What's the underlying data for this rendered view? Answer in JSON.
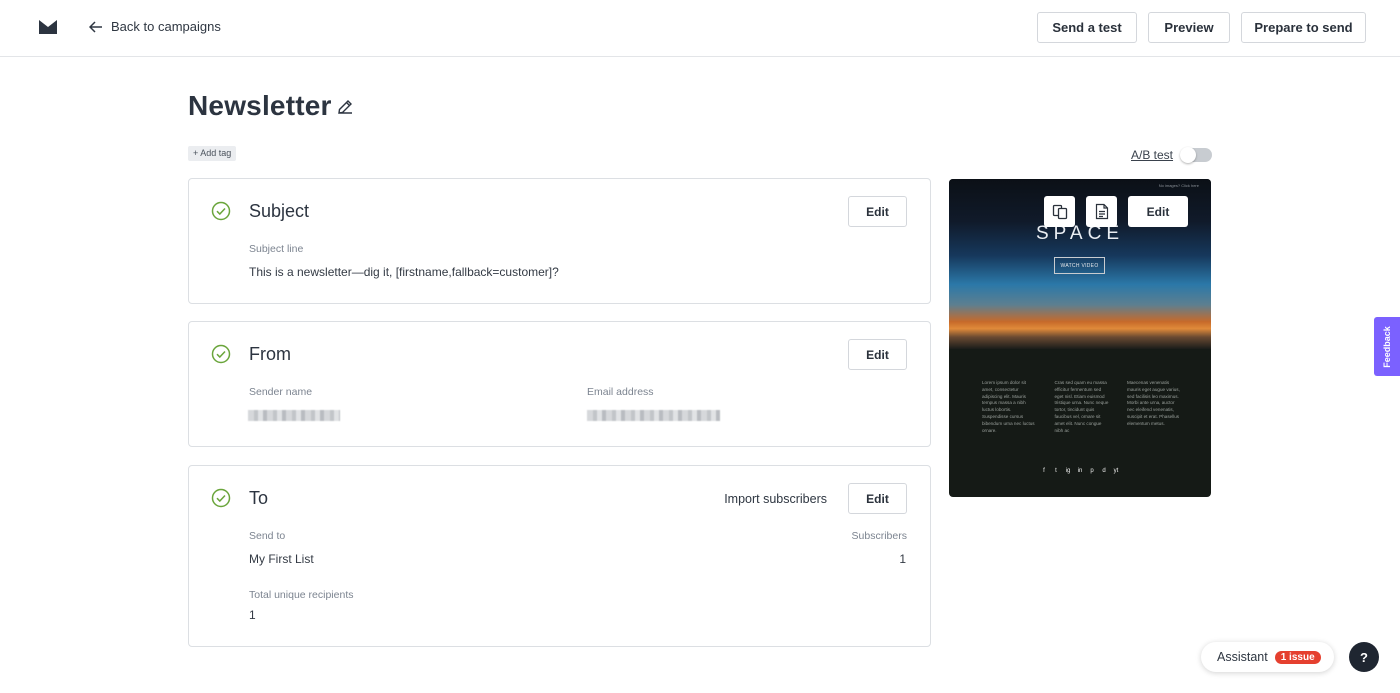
{
  "topbar": {
    "back_label": "Back to campaigns",
    "send_test_label": "Send a test",
    "preview_label": "Preview",
    "prepare_label": "Prepare to send"
  },
  "campaign": {
    "title": "Newsletter",
    "add_tag_label": "+ Add tag",
    "ab_test_label": "A/B test",
    "ab_test_enabled": false
  },
  "subject_card": {
    "title": "Subject",
    "edit_label": "Edit",
    "subject_line_label": "Subject line",
    "subject_line_value": "This is a newsletter—dig it, [firstname,fallback=customer]?"
  },
  "from_card": {
    "title": "From",
    "edit_label": "Edit",
    "sender_name_label": "Sender name",
    "email_address_label": "Email address"
  },
  "to_card": {
    "title": "To",
    "import_label": "Import subscribers",
    "edit_label": "Edit",
    "send_to_label": "Send to",
    "send_to_value": "My First List",
    "subscribers_label": "Subscribers",
    "subscribers_value": "1",
    "total_label": "Total unique recipients",
    "total_value": "1"
  },
  "preview": {
    "edit_label": "Edit",
    "top_text": "No images? Click here",
    "headline": "SPACE",
    "cta": "WATCH VIDEO",
    "columns": [
      "Lorem ipsum dolor sit amet, consectetur adipiscing elit. Mauris tempus massa a nibh luctus lobortis. Suspendisse cursus bibendum urna nec luctus ornare.",
      "Cras sed quam eu massa efficitur fermentum sed eget nisl. Etiam euismod tristique urna. Nunc neque tortor, tincidunt quis faucibus vel, ornare sit amet elit. Nunc congue nibh ac",
      "Maecenas venenatis mauris eget augue varius, sed facilisis leo maximus. Morbi ante urna, auctor nec eleifend venenatis, suscipit et erat. Phasellus elementum metus."
    ],
    "socials": [
      "f",
      "t",
      "ig",
      "in",
      "p",
      "d",
      "yt"
    ]
  },
  "feedback_label": "Feedback",
  "assistant": {
    "label": "Assistant",
    "issue_badge": "1 issue"
  },
  "help_label": "?",
  "colors": {
    "check_green": "#6aa53b",
    "feedback_purple": "#7b61ff",
    "issue_red": "#e5402f"
  }
}
